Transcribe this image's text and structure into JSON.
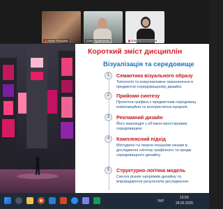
{
  "participants": [
    {
      "name": "Анна Патрова"
    },
    {
      "name": "Олег Кравченко"
    },
    {
      "name": "Ольга Михайлова"
    }
  ],
  "slide": {
    "title": "Короткий зміст дисциплін",
    "subtitle": "Візуалізація та середовище",
    "items": [
      {
        "num": "1",
        "title": "Семантика візуального образу",
        "desc": [
          "Типологія та комунікативне призначення в",
          "предметно-середовищному дизайні."
        ]
      },
      {
        "num": "2",
        "title": "Прийоми синтезу",
        "desc": [
          "Проектна графіка з предметним середовищ",
          "композиційна та колористична ієрархія."
        ]
      },
      {
        "num": "3",
        "title": "Рекламний дизайн",
        "desc": [
          "Його взаємодія з об'ємно-просторовим",
          "середовищем."
        ]
      },
      {
        "num": "4",
        "title": "Комплексний підхід",
        "desc": [
          "Методичні та творчо-пошукові ознаки в",
          "дослідженні синтезу графічного та предм",
          "середовищного дизайну."
        ]
      },
      {
        "num": "5",
        "title": "Структурно-логічна модель",
        "desc": [
          "Синтез різних напрямків дизайну та",
          "впровадження результатів дослідження."
        ]
      }
    ]
  },
  "taskbar": {
    "language": "УКР",
    "time": "10:59",
    "date": "28.02.2025"
  },
  "colors": {
    "title_red": "#d42027",
    "subtitle_blue": "#1e73be",
    "desc_blue": "#1a4d8c"
  }
}
